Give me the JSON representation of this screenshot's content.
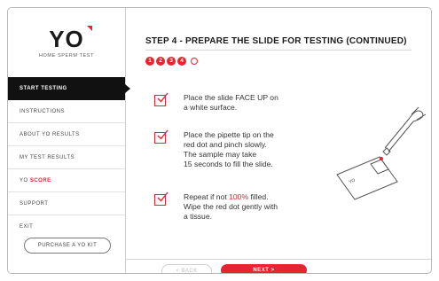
{
  "brand": {
    "logo": "YO",
    "tagline": "HOME SPERM TEST",
    "accent_color": "#e8242e"
  },
  "sidebar": {
    "items": [
      {
        "label": "START TESTING",
        "active": true
      },
      {
        "label": "INSTRUCTIONS",
        "active": false
      },
      {
        "label": "ABOUT YO RESULTS",
        "active": false
      },
      {
        "label": "MY TEST RESULTS",
        "active": false
      },
      {
        "label_prefix": "YO",
        "label_suffix": "SCORE",
        "active": false
      },
      {
        "label": "SUPPORT",
        "active": false
      },
      {
        "label": "EXIT",
        "active": false
      }
    ],
    "purchase_label": "PURCHASE A YO KIT"
  },
  "main": {
    "title": "STEP 4 - PREPARE THE SLIDE FOR TESTING (CONTINUED)",
    "steps": [
      "1",
      "2",
      "3",
      "4"
    ],
    "instructions": [
      {
        "text": "Place the slide FACE UP on\na white surface."
      },
      {
        "text": "Place the pipette tip on the\nred dot and pinch slowly.\nThe sample may take\n15 seconds to fill the slide."
      },
      {
        "text_before": "Repeat if not ",
        "highlight": "100%",
        "text_after": " filled.\nWipe the red dot gently with\na tissue."
      }
    ],
    "illustration_icon": "pipette-on-slide-illustration",
    "slide_label": "YO"
  },
  "footer": {
    "back_label": "< BACK",
    "next_label": "NEXT >"
  }
}
